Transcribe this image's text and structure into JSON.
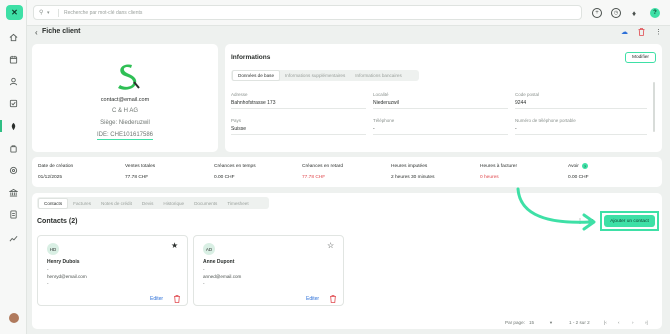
{
  "app": {
    "logo_glyph": "✕",
    "accent": "#3ee0a6",
    "danger": "#e0474c"
  },
  "sidebar": {
    "items": [
      {
        "icon": "home-icon"
      },
      {
        "icon": "calendar-icon"
      },
      {
        "icon": "users-icon"
      },
      {
        "icon": "tasks-icon"
      },
      {
        "icon": "clients-icon",
        "active": true
      },
      {
        "icon": "bag-icon"
      },
      {
        "icon": "support-icon"
      },
      {
        "icon": "bank-icon"
      },
      {
        "icon": "document-icon"
      },
      {
        "icon": "chart-icon"
      }
    ]
  },
  "topbar": {
    "search_placeholder": "Recherche par mot-clé dans clients"
  },
  "header": {
    "back_glyph": "‹",
    "title": "Fiche client"
  },
  "profile": {
    "email": "contact@email.com",
    "company": "C & H AG",
    "siege": "Siège: Niederuzwil",
    "ide": "IDE: CHE101617586"
  },
  "info": {
    "title": "Informations",
    "modifier_label": "Modifier",
    "tabs": [
      {
        "label": "Données de base",
        "active": true
      },
      {
        "label": "Informations supplémentaires",
        "active": false
      },
      {
        "label": "Informations bancaires",
        "active": false
      }
    ],
    "fields": [
      {
        "label": "Adresse",
        "value": "Bahnhofstrasse 173"
      },
      {
        "label": "Localité",
        "value": "Niederuzwil"
      },
      {
        "label": "Code postal",
        "value": "9244"
      },
      {
        "label": "Pays",
        "value": "Suisse"
      },
      {
        "label": "Téléphone",
        "value": "-"
      },
      {
        "label": "Numéro de téléphone portable",
        "value": "-"
      }
    ]
  },
  "stats": [
    {
      "label": "Date de création",
      "value": "01/12/2025",
      "alert": false
    },
    {
      "label": "Ventes totales",
      "value": "77.78 CHF",
      "alert": false
    },
    {
      "label": "Créances en temps",
      "value": "0.00 CHF",
      "alert": false
    },
    {
      "label": "Créances en retard",
      "value": "77.78 CHF",
      "alert": true
    },
    {
      "label": "Heures imputées",
      "value": "2 heures 30 minutes",
      "alert": false
    },
    {
      "label": "Heures à facturer",
      "value": "0 heures",
      "alert": true
    },
    {
      "label": "Avoir",
      "value": "0.00 CHF",
      "alert": false
    }
  ],
  "contacts_section": {
    "tabs": [
      {
        "label": "Contacts",
        "active": true
      },
      {
        "label": "Factures",
        "active": false
      },
      {
        "label": "Notes de crédit",
        "active": false
      },
      {
        "label": "Devis",
        "active": false
      },
      {
        "label": "Historique",
        "active": false
      },
      {
        "label": "Documents",
        "active": false
      },
      {
        "label": "Timesheet",
        "active": false
      }
    ],
    "title": "Contacts (2)",
    "add_label": "Ajouter un contact",
    "contacts": [
      {
        "initials": "HD",
        "name": "Henry Dubois",
        "line1": "-",
        "email": "henryd@email.com",
        "line3": "-",
        "favorite": true,
        "edit_label": "Editer"
      },
      {
        "initials": "AD",
        "name": "Anne Dupont",
        "line1": "-",
        "email": "anned@email.com",
        "line3": "-",
        "favorite": false,
        "edit_label": "Editer"
      }
    ],
    "pager": {
      "per_page_label": "Par page:",
      "per_page_value": "15",
      "range": "1 - 2 sur 2"
    }
  }
}
